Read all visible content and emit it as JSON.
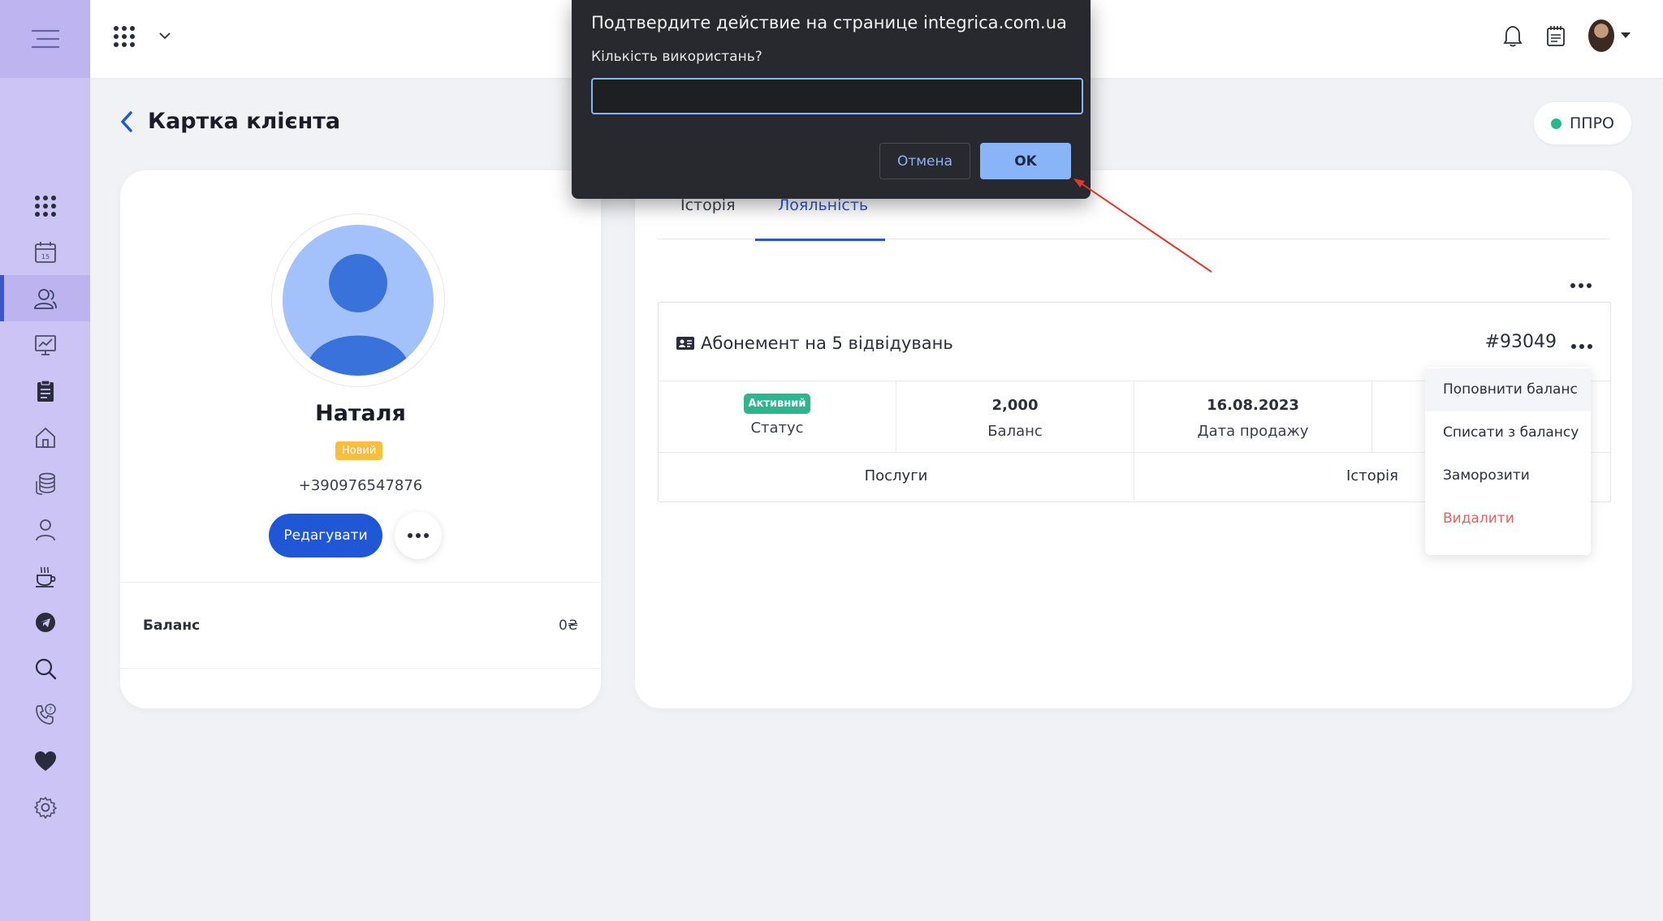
{
  "header": {
    "apps_icon": "grid-icon",
    "notifications_icon": "bell-icon",
    "notepad_icon": "notepad-icon"
  },
  "page": {
    "title": "Картка клієнта",
    "ppro_label": "ППРО",
    "ppro_status_color": "#2bb68e"
  },
  "client": {
    "name": "Наталя",
    "status_badge": "Новий",
    "phone": "+390976547876",
    "edit_label": "Редагувати",
    "balance_label": "Баланс",
    "balance_value": "0₴"
  },
  "tabs": {
    "history": "Історія",
    "loyalty": "Лояльність"
  },
  "subscription": {
    "title": "Абонемент на 5 відвідувань",
    "id": "#93049",
    "status_value": "Активний",
    "status_label": "Статус",
    "balance_value": "2,000",
    "balance_label": "Баланс",
    "sale_date_value": "16.08.2023",
    "sale_date_label": "Дата продажу",
    "services_label": "Послуги",
    "history_label": "Історія"
  },
  "dropdown": {
    "items": [
      "Поповнити баланс",
      "Списати з балансу",
      "Заморозити",
      "Видалити"
    ]
  },
  "dialog": {
    "title": "Подтвердите действие на странице integrica.com.ua",
    "prompt": "Кількість використань?",
    "input_value": "",
    "cancel_label": "Отмена",
    "ok_label": "OK"
  },
  "colors": {
    "sidebar": "#cbc4f4",
    "accent": "#1f57d6",
    "active": "#2bb68e",
    "new_badge": "#fbbd3f",
    "danger": "#e2605f",
    "annotation_arrow": "#e0392c"
  }
}
